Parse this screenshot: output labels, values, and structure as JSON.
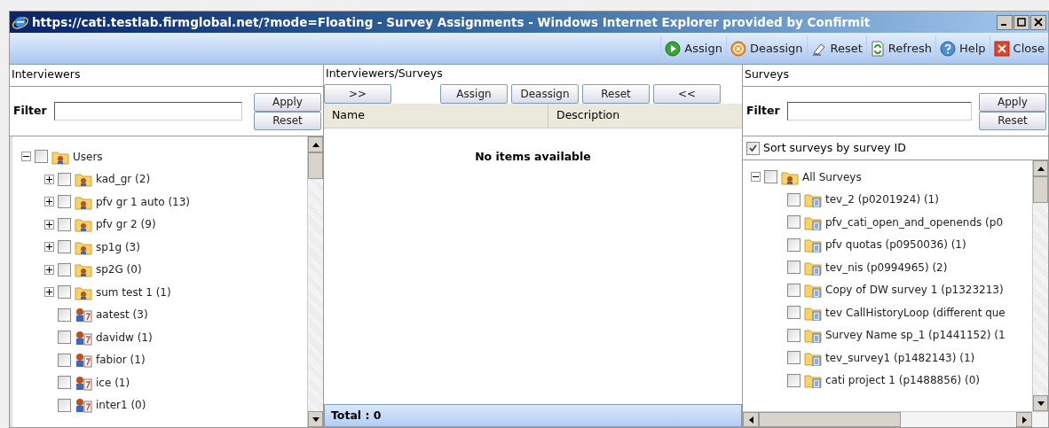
{
  "window": {
    "title": "https://cati.testlab.firmglobal.net/?mode=Floating - Survey Assignments - Windows Internet Explorer provided by Confirmit"
  },
  "toolbar": [
    {
      "label": "Assign",
      "kind": "assign"
    },
    {
      "label": "Deassign",
      "kind": "deassign"
    },
    {
      "label": "Reset",
      "kind": "reset"
    },
    {
      "label": "Refresh",
      "kind": "refresh"
    },
    {
      "label": "Help",
      "kind": "help"
    },
    {
      "label": "Close",
      "kind": "close"
    }
  ],
  "interviewers": {
    "title": "Interviewers",
    "filter_label": "Filter",
    "apply": "Apply",
    "reset": "Reset",
    "tree": [
      {
        "label": "Users",
        "kind": "root",
        "expanded": true,
        "checked": false,
        "children": [
          {
            "label": "kad_gr (2)",
            "kind": "group",
            "expanded": false,
            "checked": false
          },
          {
            "label": "pfv gr 1 auto (13)",
            "kind": "group",
            "expanded": false,
            "checked": false
          },
          {
            "label": "pfv gr 2 (9)",
            "kind": "group",
            "expanded": false,
            "checked": false
          },
          {
            "label": "sp1g (3)",
            "kind": "group",
            "expanded": false,
            "checked": false
          },
          {
            "label": "sp2G (0)",
            "kind": "group",
            "expanded": false,
            "checked": false
          },
          {
            "label": "sum test 1 (1)",
            "kind": "group",
            "expanded": false,
            "checked": false
          },
          {
            "label": "aatest (3)",
            "kind": "user",
            "checked": false
          },
          {
            "label": "davidw (1)",
            "kind": "user",
            "checked": false
          },
          {
            "label": "fabior (1)",
            "kind": "user",
            "checked": false
          },
          {
            "label": "ice (1)",
            "kind": "user",
            "checked": false
          },
          {
            "label": "inter1 (0)",
            "kind": "user",
            "checked": false
          }
        ]
      }
    ]
  },
  "assignments": {
    "title": "Interviewers/Surveys",
    "buttons": [
      ">>",
      "Assign",
      "Deassign",
      "Reset",
      "<<"
    ],
    "columns": [
      "Name",
      "Description"
    ],
    "empty_text": "No items available",
    "total": "Total : 0"
  },
  "surveys": {
    "title": "Surveys",
    "filter_label": "Filter",
    "apply": "Apply",
    "reset": "Reset",
    "sort_option": {
      "label": "Sort surveys by survey ID",
      "checked": true
    },
    "tree": [
      {
        "label": "All Surveys",
        "kind": "root",
        "expanded": true,
        "checked": false,
        "children": [
          {
            "label": "tev_2 (p0201924) (1)",
            "kind": "survey",
            "checked": false
          },
          {
            "label": "pfv_cati_open_and_openends (p0",
            "kind": "survey",
            "checked": false
          },
          {
            "label": "pfv quotas (p0950036) (1)",
            "kind": "survey",
            "checked": false
          },
          {
            "label": "tev_nis (p0994965) (2)",
            "kind": "survey",
            "checked": false
          },
          {
            "label": "Copy of DW survey 1 (p1323213)",
            "kind": "survey",
            "checked": false
          },
          {
            "label": "tev CallHistoryLoop (different que",
            "kind": "survey",
            "checked": false
          },
          {
            "label": "Survey Name sp_1 (p1441152) (1",
            "kind": "survey",
            "checked": false
          },
          {
            "label": "tev_survey1 (p1482143) (1)",
            "kind": "survey",
            "checked": false
          },
          {
            "label": "cati project 1 (p1488856) (0)",
            "kind": "survey",
            "checked": false
          }
        ]
      }
    ]
  }
}
